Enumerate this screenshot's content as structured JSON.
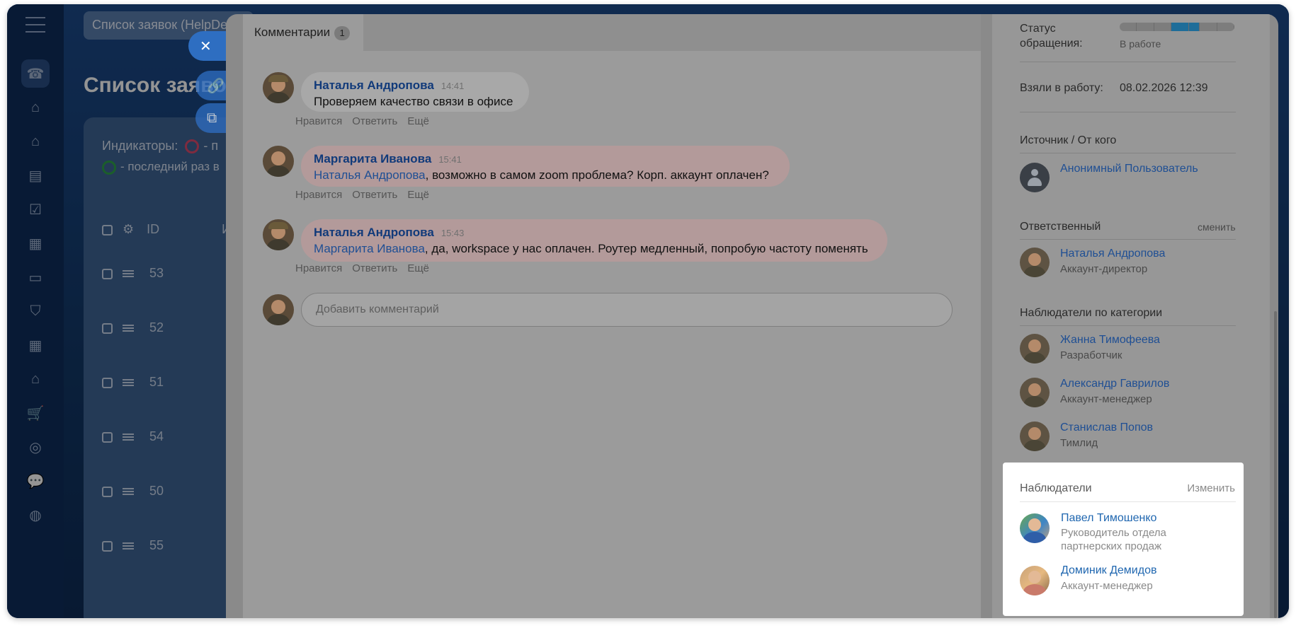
{
  "app": {
    "search_text": "Список заявок (HelpDesk)",
    "page_title": "Список заявок",
    "indicators_label": "Индикаторы:",
    "indicators_suffix": "- п",
    "indicators_line2": "- последний раз в",
    "table_header_id": "ID",
    "table_header_next": "И",
    "rows": [
      "53",
      "52",
      "51",
      "54",
      "50",
      "55"
    ]
  },
  "slider": {
    "tab_label": "Комментарии",
    "tab_count": "1",
    "comments": [
      {
        "author": "Наталья Андропова",
        "time": "14:41",
        "mention": "",
        "text": "Проверяем качество связи в офисе",
        "actions": [
          "Нравится",
          "Ответить",
          "Ещё"
        ]
      },
      {
        "author": "Маргарита Иванова",
        "time": "15:41",
        "mention": "Наталья Андропова",
        "text": ", возможно в самом zoom проблема? Корп. аккаунт оплачен?",
        "actions": [
          "Нравится",
          "Ответить",
          "Ещё"
        ]
      },
      {
        "author": "Наталья Андропова",
        "time": "15:43",
        "mention": "Маргарита Иванова",
        "text": ", да, workspace у нас оплачен. Роутер медленный, попробую частоту поменять",
        "actions": [
          "Нравится",
          "Ответить",
          "Ещё"
        ]
      }
    ],
    "add_comment_placeholder": "Добавить комментарий"
  },
  "details": {
    "status_label": "Статус обращения:",
    "status_value": "В работе",
    "status_progress": 0.5,
    "taken_label": "Взяли в работу:",
    "taken_value": "08.02.2026 12:39",
    "source_label": "Источник / От кого",
    "source_user": "Анонимный Пользователь",
    "responsible_label": "Ответственный",
    "responsible_change": "сменить",
    "responsible": {
      "name": "Наталья Андропова",
      "role": "Аккаунт-директор"
    },
    "category_watchers_label": "Наблюдатели по категории",
    "category_watchers": [
      {
        "name": "Жанна Тимофеева",
        "role": "Разработчик"
      },
      {
        "name": "Александр Гаврилов",
        "role": "Аккаунт-менеджер"
      },
      {
        "name": "Станислав Попов",
        "role": "Тимлид"
      }
    ]
  },
  "watchers": {
    "title": "Наблюдатели",
    "change_label": "Изменить",
    "items": [
      {
        "name": "Павел Тимошенко",
        "role": "Руководитель отдела партнерских продаж"
      },
      {
        "name": "Доминик Демидов",
        "role": "Аккаунт-менеджер"
      }
    ]
  },
  "colors": {
    "accent": "#2067b0",
    "nav_bg": "#0f2e5c",
    "status_on": "#1e6d99"
  }
}
